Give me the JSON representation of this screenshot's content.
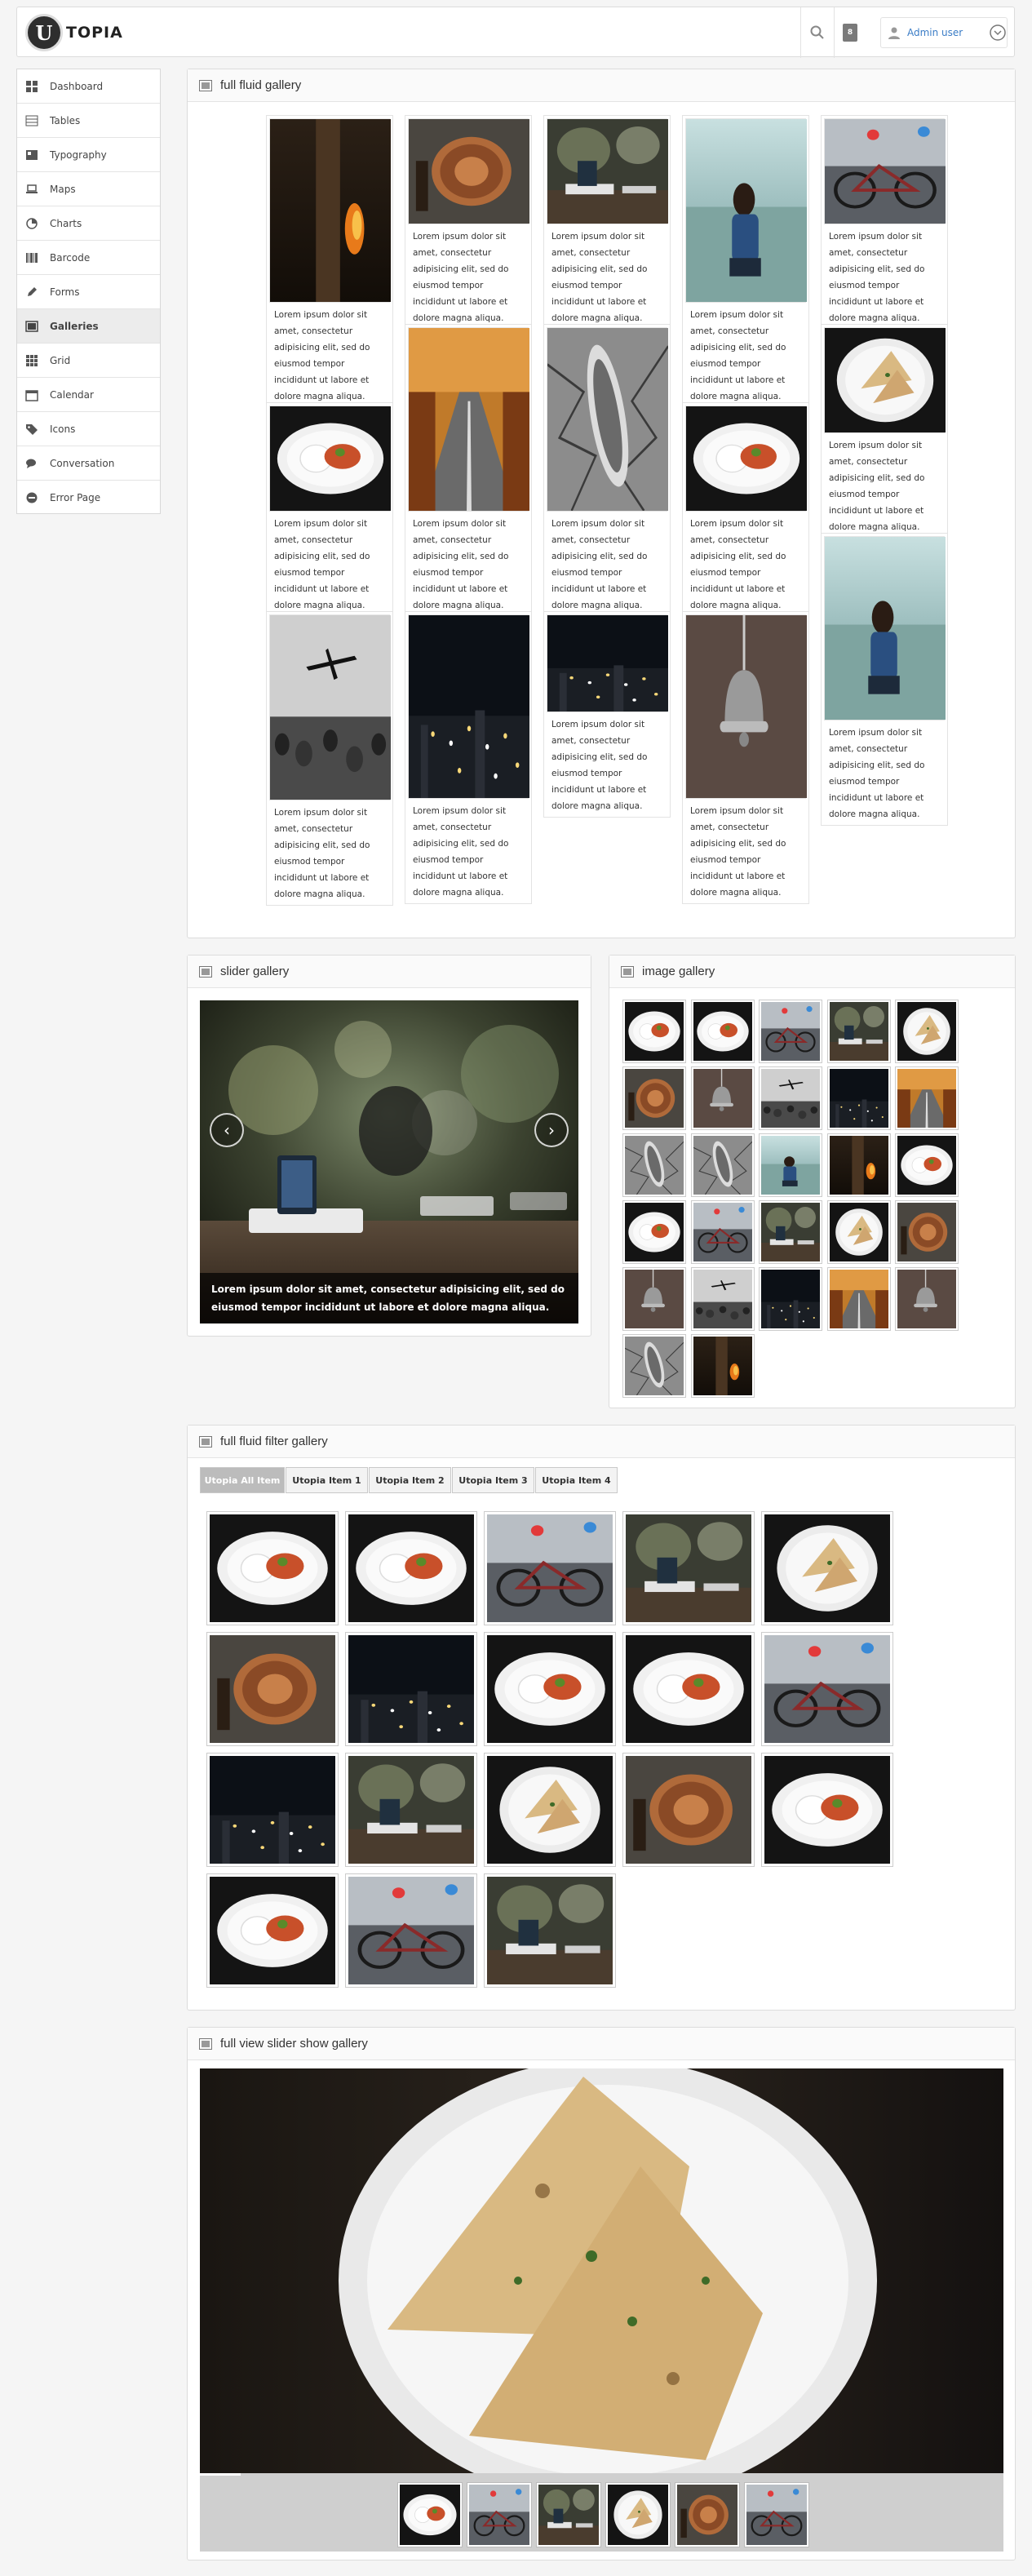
{
  "app": {
    "logo_letter": "U",
    "logo_text": "TOPIA"
  },
  "topbar": {
    "notif_count": "8",
    "user_name": "Admin user"
  },
  "sidebar": {
    "items": [
      {
        "label": "Dashboard",
        "icon": "dashboard-icon"
      },
      {
        "label": "Tables",
        "icon": "table-icon"
      },
      {
        "label": "Typography",
        "icon": "typography-icon"
      },
      {
        "label": "Maps",
        "icon": "laptop-icon"
      },
      {
        "label": "Charts",
        "icon": "pie-chart-icon"
      },
      {
        "label": "Barcode",
        "icon": "barcode-icon"
      },
      {
        "label": "Forms",
        "icon": "pencil-icon"
      },
      {
        "label": "Galleries",
        "icon": "image-icon",
        "active": true
      },
      {
        "label": "Grid",
        "icon": "grid-icon"
      },
      {
        "label": "Calendar",
        "icon": "calendar-icon"
      },
      {
        "label": "Icons",
        "icon": "tags-icon"
      },
      {
        "label": "Conversation",
        "icon": "chat-icon"
      },
      {
        "label": "Error Page",
        "icon": "minus-circle-icon"
      }
    ]
  },
  "panels": {
    "fluid": "full fluid gallery",
    "slider": "slider gallery",
    "image": "image gallery",
    "filter": "full fluid filter gallery",
    "fullview": "full view slider show gallery"
  },
  "caption": "Lorem ipsum dolor sit amet, consectetur adipisicing elit, sed do eiusmod tempor incididunt ut labore et dolore magna aliqua.",
  "slider": {
    "caption": "Lorem ipsum dolor sit amet, consectetur adipisicing elit, sed do eiusmod tempor incididunt ut labore et dolore magna aliqua."
  },
  "filter": {
    "tabs": [
      "Utopia All Item",
      "Utopia Item 1",
      "Utopia Item 2",
      "Utopia Item 3",
      "Utopia Item 4"
    ]
  },
  "photos": {
    "forest": "forest-fire photo",
    "coin": "ornate coin photo",
    "device": "dock device photo",
    "boy": "boy in water photo",
    "bike": "bicycle photo",
    "road": "autumn road photo",
    "boat": "boat on cracked earth photo",
    "plate": "food plate photo",
    "naan": "naan plate photo",
    "plane": "plane over crowd photo",
    "city": "city at night photo",
    "bell": "bell photo"
  }
}
